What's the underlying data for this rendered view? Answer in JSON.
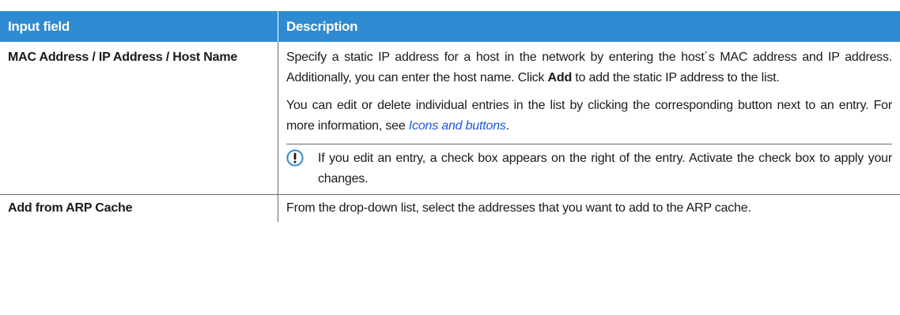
{
  "header": {
    "col1": "Input field",
    "col2": "Description"
  },
  "rows": [
    {
      "field": "MAC Address / IP Address / Host Name",
      "para1_pre": "Specify a static IP address for a host in the network by entering the host´s MAC address and IP address. Additionally, you can enter the host name. Click ",
      "para1_bold": "Add",
      "para1_post": " to add the static IP address to the list.",
      "para2_pre": "You can edit or delete individual entries in the list by clicking the corresponding button next to an entry. For more information, see ",
      "para2_link": "Icons and buttons",
      "para2_post": ".",
      "note_icon": "info-exclamation-icon",
      "note": "If you edit an entry, a check box appears on the right of the entry. Activate the check box to apply your changes."
    },
    {
      "field": "Add from ARP Cache",
      "description": "From the drop-down list, select the addresses that you want to add to the ARP cache."
    }
  ],
  "colors": {
    "header_bg": "#2e8bd1",
    "link": "#1a56d8",
    "icon": "#2e8bd1"
  }
}
